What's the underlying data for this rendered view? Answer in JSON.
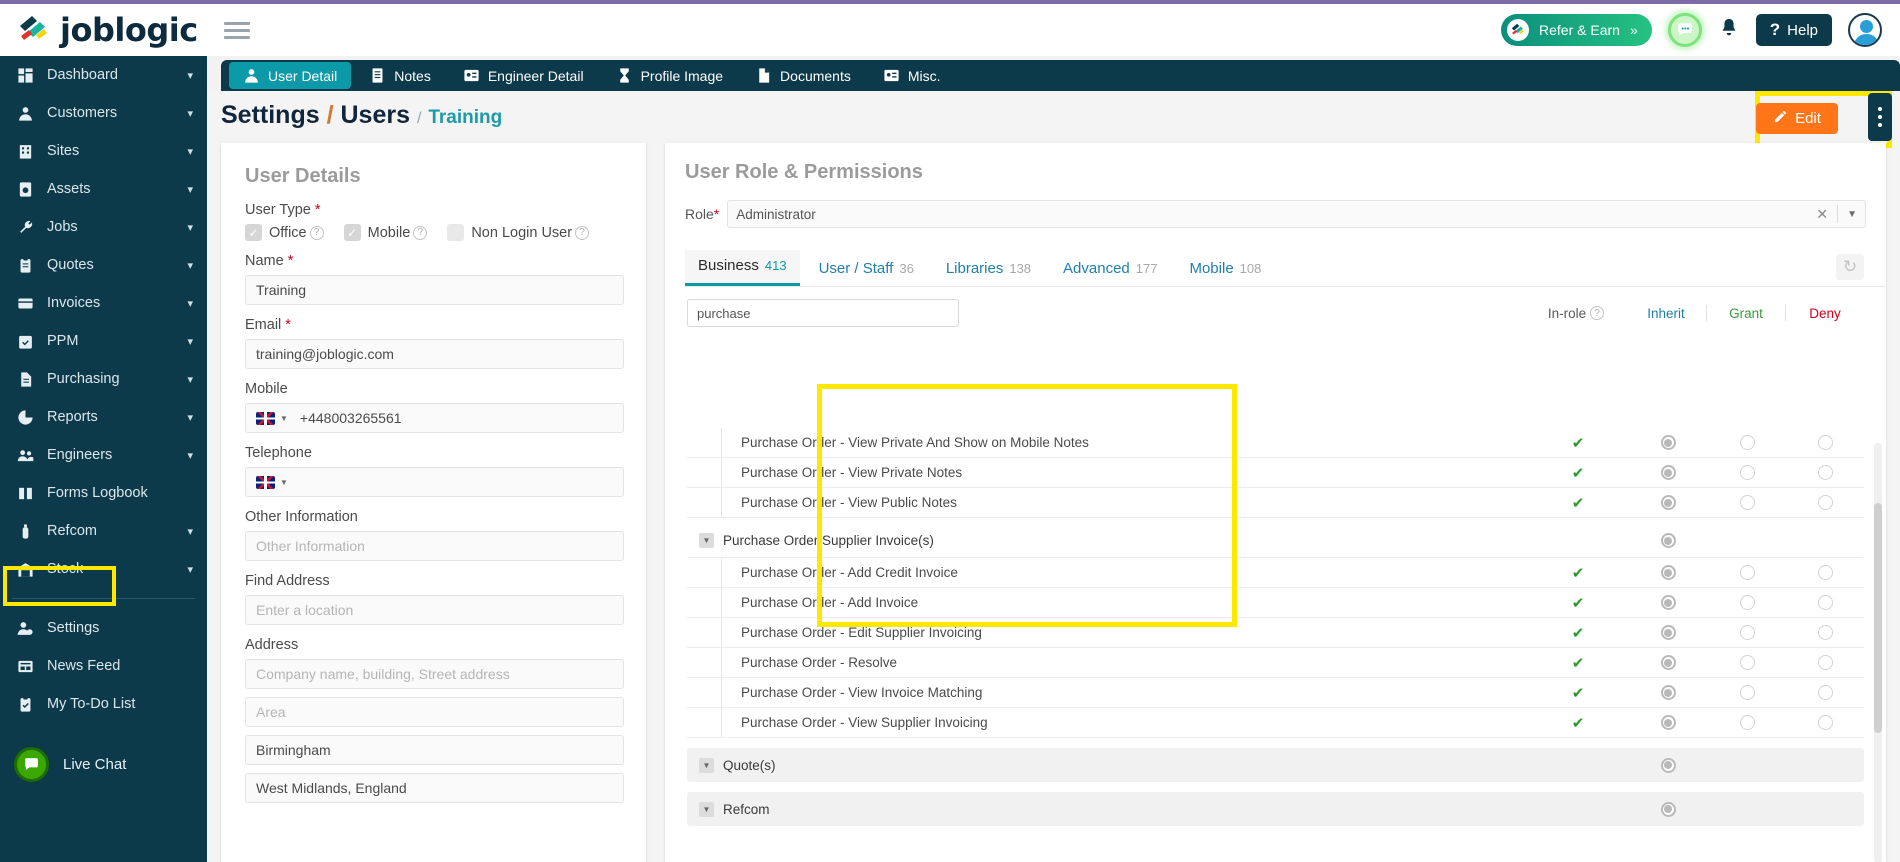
{
  "brand": {
    "name": "joblogic",
    "logo_icon": "joblogic-logo-icon"
  },
  "header": {
    "hamburger_icon": "hamburger-icon",
    "refer": {
      "label": "Refer & Earn",
      "chevrons": "»",
      "icon": "joblogic-badge-icon"
    },
    "chat_icon": "chat-bubble-icon",
    "bell_icon": "notification-bell-icon",
    "help": {
      "label": "Help",
      "icon": "question-mark-icon"
    },
    "avatar_icon": "user-avatar-icon"
  },
  "sidebar": {
    "items": [
      {
        "label": "Dashboard",
        "icon": "dashboard-icon",
        "chevron": true
      },
      {
        "label": "Customers",
        "icon": "customers-icon",
        "chevron": true
      },
      {
        "label": "Sites",
        "icon": "sites-icon",
        "chevron": true
      },
      {
        "label": "Assets",
        "icon": "assets-icon",
        "chevron": true
      },
      {
        "label": "Jobs",
        "icon": "wrench-icon",
        "chevron": true
      },
      {
        "label": "Quotes",
        "icon": "clipboard-icon",
        "chevron": true
      },
      {
        "label": "Invoices",
        "icon": "invoice-card-icon",
        "chevron": true
      },
      {
        "label": "PPM",
        "icon": "calendar-check-icon",
        "chevron": true
      },
      {
        "label": "Purchasing",
        "icon": "document-lines-icon",
        "chevron": true
      },
      {
        "label": "Reports",
        "icon": "pie-chart-icon",
        "chevron": true
      },
      {
        "label": "Engineers",
        "icon": "people-icon",
        "chevron": true
      },
      {
        "label": "Forms Logbook",
        "icon": "open-book-icon",
        "chevron": false
      },
      {
        "label": "Refcom",
        "icon": "cylinder-icon",
        "chevron": true
      },
      {
        "label": "Stock",
        "icon": "warehouse-icon",
        "chevron": true
      }
    ],
    "bottom_items": [
      {
        "label": "Settings",
        "icon": "user-gear-icon",
        "chevron": false,
        "highlighted": true
      },
      {
        "label": "News Feed",
        "icon": "news-feed-icon",
        "chevron": false
      },
      {
        "label": "My To-Do List",
        "icon": "todo-clipboard-icon",
        "chevron": false
      }
    ],
    "live_chat": {
      "label": "Live Chat",
      "icon": "live-chat-icon"
    }
  },
  "tabs": [
    {
      "label": "User Detail",
      "icon": "user-icon",
      "active": true
    },
    {
      "label": "Notes",
      "icon": "notes-icon",
      "active": false
    },
    {
      "label": "Engineer Detail",
      "icon": "id-card-icon",
      "active": false
    },
    {
      "label": "Profile Image",
      "icon": "hourglass-icon",
      "active": false
    },
    {
      "label": "Documents",
      "icon": "document-icon",
      "active": false
    },
    {
      "label": "Misc.",
      "icon": "id-card-icon",
      "active": false
    }
  ],
  "breadcrumb": {
    "part1": "Settings",
    "slash1": "/",
    "part2": "Users",
    "slash2": "/",
    "part3": "Training"
  },
  "actions": {
    "edit_label": "Edit",
    "edit_icon": "pencil-icon",
    "kebab_icon": "kebab-menu-icon"
  },
  "user_details": {
    "title": "User Details",
    "user_type_label": "User Type",
    "checkboxes": [
      {
        "label": "Office",
        "checked": true,
        "help_icon": "help-circle-icon"
      },
      {
        "label": "Mobile",
        "checked": true,
        "help_icon": "help-circle-icon"
      },
      {
        "label": "Non Login User",
        "checked": false,
        "help_icon": "help-circle-icon"
      }
    ],
    "fields": [
      {
        "label": "Name",
        "required": true,
        "value": "Training",
        "placeholder": ""
      },
      {
        "label": "Email",
        "required": true,
        "value": "training@joblogic.com",
        "placeholder": ""
      },
      {
        "label": "Mobile",
        "required": false,
        "value": "+448003265561",
        "placeholder": "",
        "flag": "uk-flag-icon"
      },
      {
        "label": "Telephone",
        "required": false,
        "value": "",
        "placeholder": "",
        "flag": "uk-flag-icon"
      },
      {
        "label": "Other Information",
        "required": false,
        "value": "",
        "placeholder": "Other Information"
      },
      {
        "label": "Find Address",
        "required": false,
        "value": "",
        "placeholder": "Enter a location"
      }
    ],
    "address_label": "Address",
    "address_lines": [
      {
        "value": "",
        "placeholder": "Company name, building, Street address"
      },
      {
        "value": "",
        "placeholder": "Area"
      },
      {
        "value": "Birmingham",
        "placeholder": ""
      },
      {
        "value": "West Midlands, England",
        "placeholder": ""
      }
    ]
  },
  "permissions": {
    "title": "User Role & Permissions",
    "role_label": "Role",
    "role_value": "Administrator",
    "role_clear_icon": "clear-x-icon",
    "role_caret_icon": "chevron-down-icon",
    "refresh_icon": "refresh-icon",
    "tabs": [
      {
        "label": "Business",
        "count": "413",
        "active": true
      },
      {
        "label": "User / Staff",
        "count": "36",
        "active": false
      },
      {
        "label": "Libraries",
        "count": "138",
        "active": false
      },
      {
        "label": "Advanced",
        "count": "177",
        "active": false
      },
      {
        "label": "Mobile",
        "count": "108",
        "active": false
      }
    ],
    "search_value": "purchase",
    "search_placeholder": "",
    "columns": {
      "in_role": "In-role",
      "in_role_help_icon": "help-circle-icon",
      "inherit": "Inherit",
      "grant": "Grant",
      "deny": "Deny"
    },
    "rows": [
      {
        "type": "perm",
        "label": "Purchase Order - View Private And Show on Mobile Notes",
        "in_role": true,
        "inherit": true,
        "grant": false,
        "deny": false
      },
      {
        "type": "perm",
        "label": "Purchase Order - View Private Notes",
        "in_role": true,
        "inherit": true,
        "grant": false,
        "deny": false
      },
      {
        "type": "perm",
        "label": "Purchase Order - View Public Notes",
        "in_role": true,
        "inherit": true,
        "grant": false,
        "deny": false
      },
      {
        "type": "group-plain",
        "label": "Purchase Order Supplier Invoice(s)",
        "in_role": false,
        "inherit": true,
        "grant": false,
        "deny": false
      },
      {
        "type": "perm",
        "label": "Purchase Order - Add Credit Invoice",
        "in_role": true,
        "inherit": true,
        "grant": false,
        "deny": false
      },
      {
        "type": "perm",
        "label": "Purchase Order - Add Invoice",
        "in_role": true,
        "inherit": true,
        "grant": false,
        "deny": false
      },
      {
        "type": "perm",
        "label": "Purchase Order - Edit Supplier Invoicing",
        "in_role": true,
        "inherit": true,
        "grant": false,
        "deny": false
      },
      {
        "type": "perm",
        "label": "Purchase Order - Resolve",
        "in_role": true,
        "inherit": true,
        "grant": false,
        "deny": false
      },
      {
        "type": "perm",
        "label": "Purchase Order - View Invoice Matching",
        "in_role": true,
        "inherit": true,
        "grant": false,
        "deny": false
      },
      {
        "type": "perm",
        "label": "Purchase Order - View Supplier Invoicing",
        "in_role": true,
        "inherit": true,
        "grant": false,
        "deny": false
      },
      {
        "type": "group",
        "label": "Quote(s)",
        "in_role": false,
        "inherit": true,
        "grant": false,
        "deny": false
      },
      {
        "type": "group",
        "label": "Refcom",
        "in_role": false,
        "inherit": true,
        "grant": false,
        "deny": false
      }
    ]
  },
  "colors": {
    "brand_dark": "#0d3a4a",
    "accent_teal": "#0d9aa8",
    "edit_orange": "#ff7518",
    "highlight_yellow": "#ffe800",
    "deny_red": "#d0021b",
    "grant_green": "#3a9a3a"
  }
}
